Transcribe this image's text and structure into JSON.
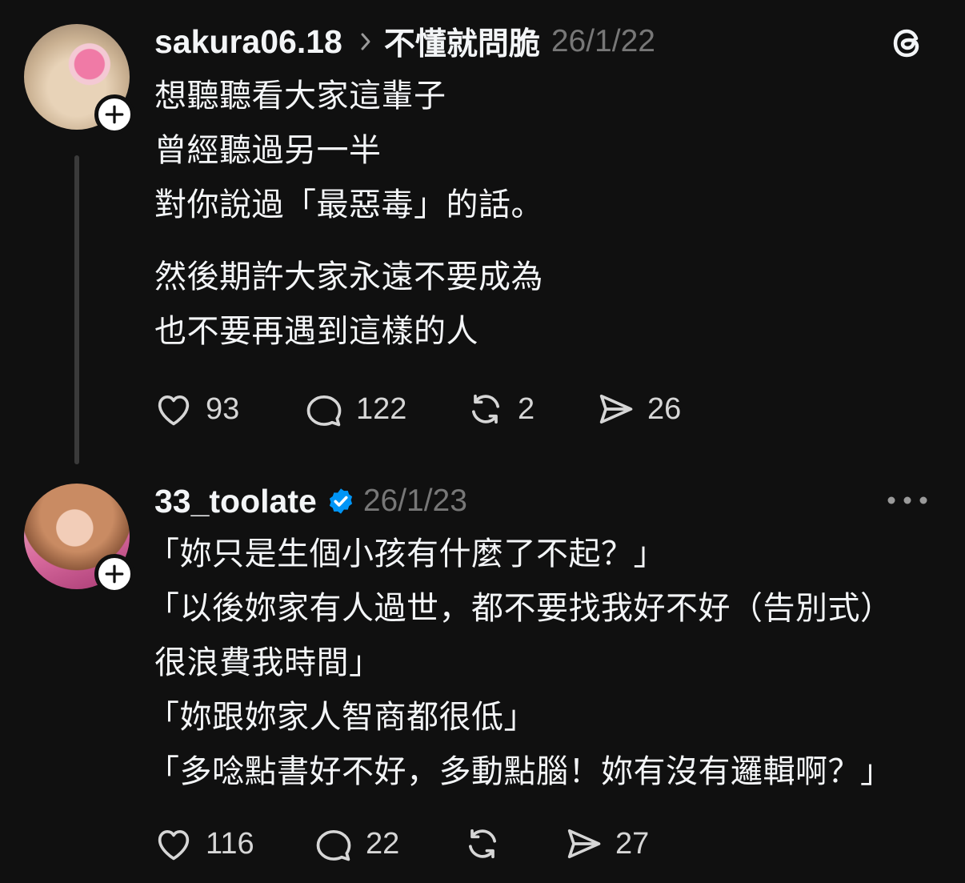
{
  "post1": {
    "username": "sakura06.18",
    "topic": "不懂就問脆",
    "timestamp": "26/1/22",
    "lines": [
      "想聽聽看大家這輩子",
      "曾經聽過另一半",
      "對你說過「最惡毒」的話。",
      "然後期許大家永遠不要成為",
      "也不要再遇到這樣的人"
    ],
    "likes": "93",
    "replies": "122",
    "reposts": "2",
    "shares": "26",
    "icons": {
      "logo": "threads-logo-icon",
      "follow": "plus-icon"
    }
  },
  "post2": {
    "username": "33_toolate",
    "verified": true,
    "timestamp": "26/1/23",
    "lines": [
      "「妳只是生個小孩有什麼了不起？」",
      "「以後妳家有人過世，都不要找我好不好（告別式）",
      "很浪費我時間」",
      "「妳跟妳家人智商都很低」",
      "「多唸點書好不好，多動點腦！妳有沒有邏輯啊？」"
    ],
    "likes": "116",
    "replies": "22",
    "reposts": "",
    "shares": "27",
    "icons": {
      "more": "more-icon",
      "verified": "verified-badge-icon"
    }
  },
  "colors": {
    "background": "#101010",
    "text": "#f3f5f7",
    "muted": "#777777",
    "verified": "#0095f6"
  }
}
